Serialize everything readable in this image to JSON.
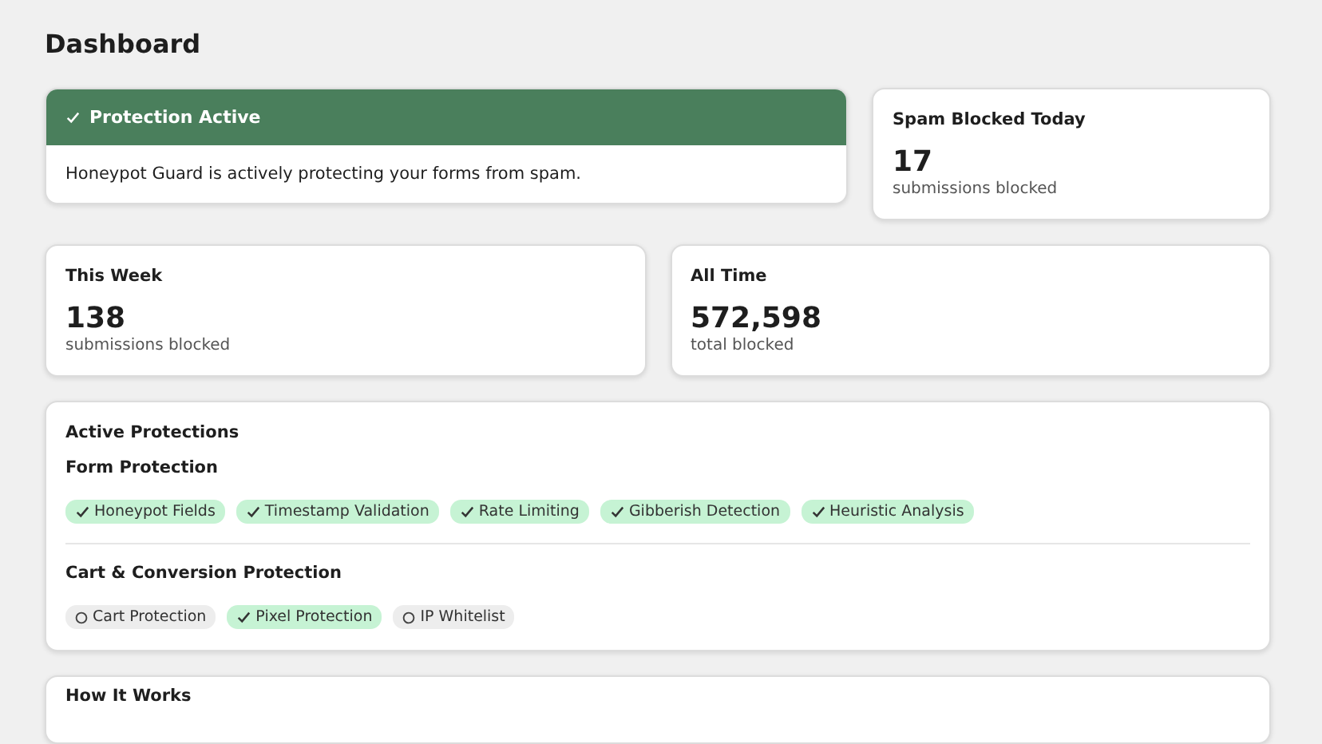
{
  "page": {
    "title": "Dashboard"
  },
  "status": {
    "title": "Protection Active",
    "active": true,
    "message": "Honeypot Guard is actively protecting your forms from spam."
  },
  "today": {
    "title": "Spam Blocked Today",
    "value": "17",
    "caption": "submissions blocked"
  },
  "stats": [
    {
      "title": "This Week",
      "value": "138",
      "caption": "submissions blocked"
    },
    {
      "title": "All Time",
      "value": "572,598",
      "caption": "total blocked"
    }
  ],
  "protections": {
    "title": "Active Protections",
    "groups": [
      {
        "title": "Form Protection",
        "items": [
          {
            "label": "Honeypot Fields",
            "on": true
          },
          {
            "label": "Timestamp Validation",
            "on": true
          },
          {
            "label": "Rate Limiting",
            "on": true
          },
          {
            "label": "Gibberish Detection",
            "on": true
          },
          {
            "label": "Heuristic Analysis",
            "on": true
          }
        ]
      },
      {
        "title": "Cart & Conversion Protection",
        "items": [
          {
            "label": "Cart Protection",
            "on": false
          },
          {
            "label": "Pixel Protection",
            "on": true
          },
          {
            "label": "IP Whitelist",
            "on": false
          }
        ]
      }
    ]
  },
  "how_it_works": {
    "title": "How It Works"
  }
}
